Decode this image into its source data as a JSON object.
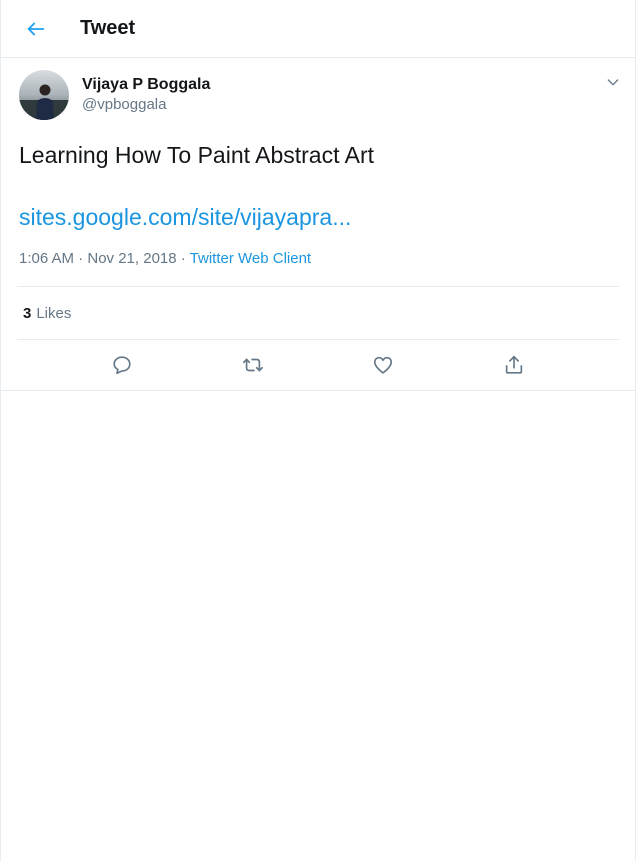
{
  "header": {
    "title": "Tweet",
    "back_icon": "arrow-left-icon"
  },
  "tweet": {
    "author": {
      "display_name": "Vijaya P Boggala",
      "handle": "@vpboggala"
    },
    "text": "Learning How To Paint Abstract Art",
    "link": "sites.google.com/site/vijayapra...",
    "timestamp": "1:06 AM · Nov 21, 2018 · ",
    "source": "Twitter Web Client",
    "likes_count": "3",
    "likes_label": "Likes"
  },
  "actions": {
    "reply_icon": "reply-icon",
    "retweet_icon": "retweet-icon",
    "like_icon": "heart-icon",
    "share_icon": "share-icon"
  },
  "colors": {
    "accent": "#1b95e0",
    "text_primary": "#14171a",
    "text_secondary": "#657786",
    "border": "#e6ecf0"
  }
}
